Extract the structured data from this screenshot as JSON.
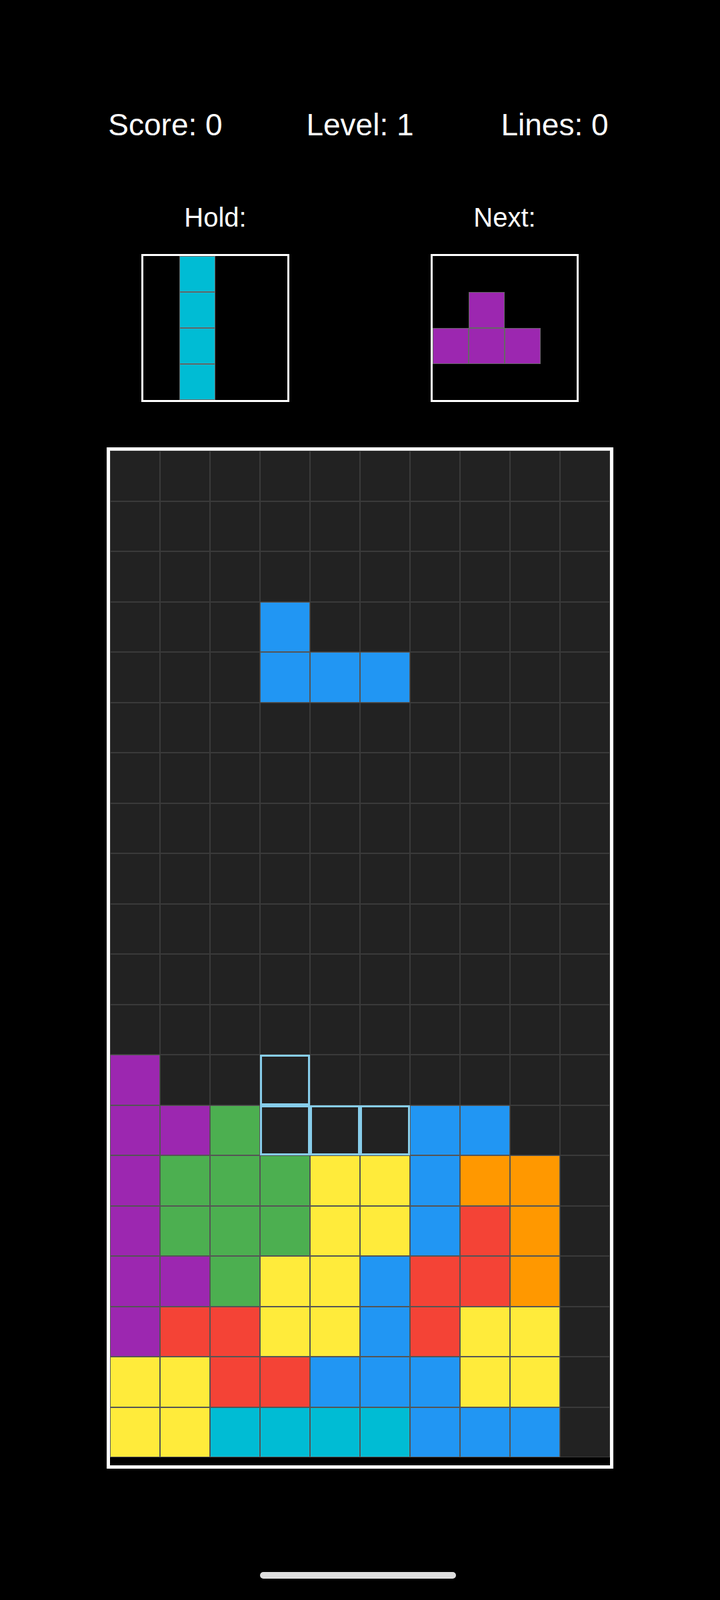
{
  "stats": [
    "Score: 0",
    "Level: 1",
    "Lines: 0"
  ],
  "hold": {
    "label": "Hold:",
    "cells": [
      [
        "",
        "#00bcd4",
        "",
        ""
      ],
      [
        "",
        "#00bcd4",
        "",
        ""
      ],
      [
        "",
        "#00bcd4",
        "",
        ""
      ],
      [
        "",
        "#00bcd4",
        "",
        ""
      ]
    ]
  },
  "next": {
    "label": "Next:",
    "cells": [
      [
        "",
        "",
        "",
        ""
      ],
      [
        "",
        "#9c27b0",
        "",
        ""
      ],
      [
        "#9c27b0",
        "#9c27b0",
        "#9c27b0",
        ""
      ],
      [
        "",
        "",
        "",
        ""
      ]
    ]
  },
  "board": {
    "rows": [
      [
        "",
        "",
        "",
        "",
        "",
        "",
        "",
        "",
        "",
        ""
      ],
      [
        "",
        "",
        "",
        "",
        "",
        "",
        "",
        "",
        "",
        ""
      ],
      [
        "",
        "",
        "",
        "",
        "",
        "",
        "",
        "",
        "",
        ""
      ],
      [
        "",
        "",
        "",
        "#2196f3",
        "",
        "",
        "",
        "",
        "",
        ""
      ],
      [
        "",
        "",
        "",
        "#2196f3",
        "#2196f3",
        "#2196f3",
        "",
        "",
        "",
        ""
      ],
      [
        "",
        "",
        "",
        "",
        "",
        "",
        "",
        "",
        "",
        ""
      ],
      [
        "",
        "",
        "",
        "",
        "",
        "",
        "",
        "",
        "",
        ""
      ],
      [
        "",
        "",
        "",
        "",
        "",
        "",
        "",
        "",
        "",
        ""
      ],
      [
        "",
        "",
        "",
        "",
        "",
        "",
        "",
        "",
        "",
        ""
      ],
      [
        "",
        "",
        "",
        "",
        "",
        "",
        "",
        "",
        "",
        ""
      ],
      [
        "",
        "",
        "",
        "",
        "",
        "",
        "",
        "",
        "",
        ""
      ],
      [
        "",
        "",
        "",
        "",
        "",
        "",
        "",
        "",
        "",
        ""
      ],
      [
        "#9c27b0",
        "",
        "",
        "",
        "",
        "",
        "",
        "",
        "",
        ""
      ],
      [
        "#9c27b0",
        "#9c27b0",
        "#4caf50",
        "",
        "",
        "",
        "#2196f3",
        "#2196f3",
        "",
        ""
      ],
      [
        "#9c27b0",
        "#4caf50",
        "#4caf50",
        "#4caf50",
        "#ffeb3b",
        "#ffeb3b",
        "#2196f3",
        "#ff9800",
        "#ff9800",
        ""
      ],
      [
        "#9c27b0",
        "#4caf50",
        "#4caf50",
        "#4caf50",
        "#ffeb3b",
        "#ffeb3b",
        "#2196f3",
        "#f44336",
        "#ff9800",
        ""
      ],
      [
        "#9c27b0",
        "#9c27b0",
        "#4caf50",
        "#ffeb3b",
        "#ffeb3b",
        "#2196f3",
        "#f44336",
        "#f44336",
        "#ff9800",
        ""
      ],
      [
        "#9c27b0",
        "#f44336",
        "#f44336",
        "#ffeb3b",
        "#ffeb3b",
        "#2196f3",
        "#f44336",
        "#ffeb3b",
        "#ffeb3b",
        ""
      ],
      [
        "#ffeb3b",
        "#ffeb3b",
        "#f44336",
        "#f44336",
        "#2196f3",
        "#2196f3",
        "#2196f3",
        "#ffeb3b",
        "#ffeb3b",
        ""
      ],
      [
        "#ffeb3b",
        "#ffeb3b",
        "#00bcd4",
        "#00bcd4",
        "#00bcd4",
        "#00bcd4",
        "#2196f3",
        "#2196f3",
        "#2196f3",
        ""
      ]
    ],
    "ghost": [
      [
        12,
        3
      ],
      [
        13,
        3
      ],
      [
        13,
        4
      ],
      [
        13,
        5
      ]
    ]
  }
}
